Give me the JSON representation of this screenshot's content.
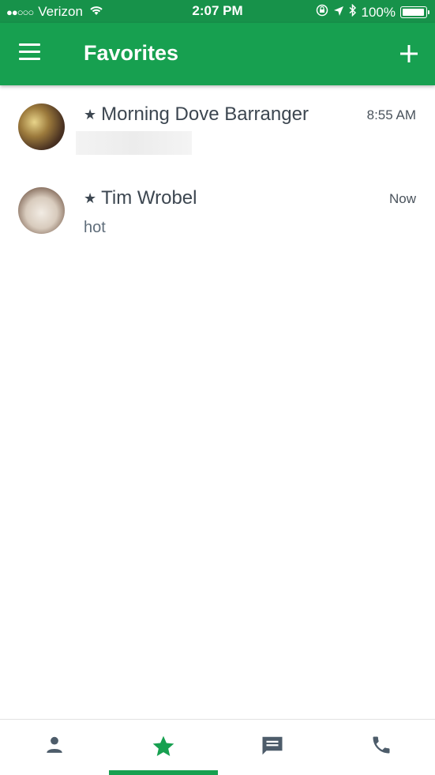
{
  "status_bar": {
    "signal_dots": "●●○○○",
    "carrier": "Verizon",
    "time": "2:07 PM",
    "battery_percent": "100%",
    "battery_level": 1.0,
    "icons": [
      "wifi-icon",
      "rotation-lock-icon",
      "location-icon",
      "bluetooth-icon",
      "battery-icon"
    ]
  },
  "app_bar": {
    "title": "Favorites",
    "menu_icon": "menu-icon",
    "add_icon": "plus-icon",
    "color": "#17a050"
  },
  "favorites": [
    {
      "name": "Morning Dove Barranger",
      "time": "8:55 AM",
      "preview": "",
      "starred": true
    },
    {
      "name": "Tim Wrobel",
      "time": "Now",
      "preview": "hot",
      "starred": true
    }
  ],
  "bottom_nav": {
    "tabs": [
      {
        "icon": "person-icon",
        "selected": false
      },
      {
        "icon": "star-icon",
        "selected": true
      },
      {
        "icon": "message-icon",
        "selected": false
      },
      {
        "icon": "phone-icon",
        "selected": false
      }
    ],
    "accent": "#17a050",
    "inactive": "#4d5c6a"
  }
}
